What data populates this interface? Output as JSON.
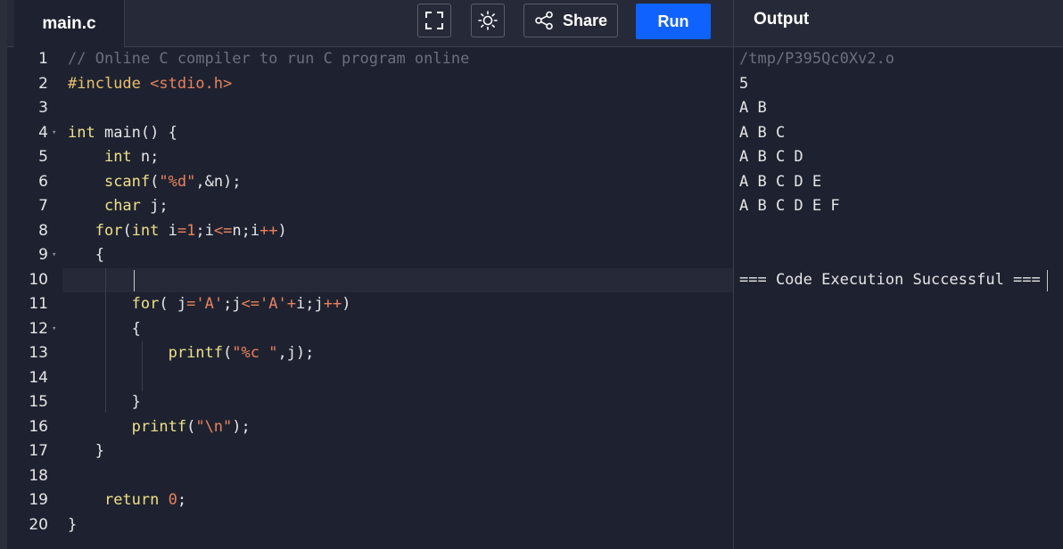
{
  "editor": {
    "file_name": "main.c",
    "lines": [
      {
        "n": "1",
        "tokens": [
          {
            "t": "// Online C compiler to run C program online",
            "c": "cm"
          }
        ]
      },
      {
        "n": "2",
        "tokens": [
          {
            "t": "#include ",
            "c": "inc"
          },
          {
            "t": "<stdio.h>",
            "c": "str"
          }
        ]
      },
      {
        "n": "3",
        "tokens": []
      },
      {
        "n": "4",
        "fold": true,
        "tokens": [
          {
            "t": "int",
            "c": "kw"
          },
          {
            "t": " main() {",
            "c": ""
          }
        ]
      },
      {
        "n": "5",
        "tokens": [
          {
            "t": "    ",
            "c": ""
          },
          {
            "t": "int",
            "c": "kw"
          },
          {
            "t": " n;",
            "c": ""
          }
        ]
      },
      {
        "n": "6",
        "tokens": [
          {
            "t": "    ",
            "c": ""
          },
          {
            "t": "scanf",
            "c": "kw"
          },
          {
            "t": "(",
            "c": ""
          },
          {
            "t": "\"%d\"",
            "c": "str"
          },
          {
            "t": ",&n);",
            "c": ""
          }
        ]
      },
      {
        "n": "7",
        "tokens": [
          {
            "t": "    ",
            "c": ""
          },
          {
            "t": "char",
            "c": "kw"
          },
          {
            "t": " j;",
            "c": ""
          }
        ]
      },
      {
        "n": "8",
        "tokens": [
          {
            "t": "   ",
            "c": ""
          },
          {
            "t": "for",
            "c": "kw"
          },
          {
            "t": "(",
            "c": ""
          },
          {
            "t": "int",
            "c": "kw"
          },
          {
            "t": " i",
            "c": ""
          },
          {
            "t": "=1",
            "c": "num"
          },
          {
            "t": ";i",
            "c": ""
          },
          {
            "t": "<=",
            "c": "str"
          },
          {
            "t": "n;i",
            "c": ""
          },
          {
            "t": "++",
            "c": "str"
          },
          {
            "t": ")",
            "c": ""
          }
        ]
      },
      {
        "n": "9",
        "fold": true,
        "tokens": [
          {
            "t": "   {",
            "c": ""
          }
        ]
      },
      {
        "n": "10",
        "tokens": []
      },
      {
        "n": "11",
        "tokens": [
          {
            "t": "       ",
            "c": ""
          },
          {
            "t": "for",
            "c": "kw"
          },
          {
            "t": "( j",
            "c": ""
          },
          {
            "t": "=",
            "c": "str"
          },
          {
            "t": "'A'",
            "c": "str"
          },
          {
            "t": ";j",
            "c": ""
          },
          {
            "t": "<=",
            "c": "str"
          },
          {
            "t": "'A'",
            "c": "str"
          },
          {
            "t": "+",
            "c": "str"
          },
          {
            "t": "i;j",
            "c": ""
          },
          {
            "t": "++",
            "c": "str"
          },
          {
            "t": ")",
            "c": ""
          }
        ]
      },
      {
        "n": "12",
        "fold": true,
        "tokens": [
          {
            "t": "       {",
            "c": ""
          }
        ]
      },
      {
        "n": "13",
        "tokens": [
          {
            "t": "           ",
            "c": ""
          },
          {
            "t": "printf",
            "c": "kw"
          },
          {
            "t": "(",
            "c": ""
          },
          {
            "t": "\"%c \"",
            "c": "str"
          },
          {
            "t": ",j);",
            "c": ""
          }
        ]
      },
      {
        "n": "14",
        "tokens": []
      },
      {
        "n": "15",
        "tokens": [
          {
            "t": "       }",
            "c": ""
          }
        ]
      },
      {
        "n": "16",
        "tokens": [
          {
            "t": "       ",
            "c": ""
          },
          {
            "t": "printf",
            "c": "kw"
          },
          {
            "t": "(",
            "c": ""
          },
          {
            "t": "\"\\n\"",
            "c": "str"
          },
          {
            "t": ");",
            "c": ""
          }
        ]
      },
      {
        "n": "17",
        "tokens": [
          {
            "t": "   }",
            "c": ""
          }
        ]
      },
      {
        "n": "18",
        "tokens": []
      },
      {
        "n": "19",
        "tokens": [
          {
            "t": "    ",
            "c": ""
          },
          {
            "t": "return",
            "c": "kw"
          },
          {
            "t": " ",
            "c": ""
          },
          {
            "t": "0",
            "c": "num"
          },
          {
            "t": ";",
            "c": ""
          }
        ]
      },
      {
        "n": "20",
        "tokens": [
          {
            "t": "}",
            "c": ""
          }
        ]
      }
    ]
  },
  "toolbar": {
    "fullscreen_icon": "fullscreen-icon",
    "theme_icon": "sun-icon",
    "share_icon": "share-icon",
    "share_label": "Share",
    "run_label": "Run"
  },
  "output": {
    "title": "Output",
    "lines": [
      "/tmp/P395Qc0Xv2.o",
      "5",
      "A B",
      "A B C",
      "A B C D",
      "A B C D E",
      "A B C D E F",
      "",
      "",
      "=== Code Execution Successful ==="
    ]
  },
  "colors": {
    "background": "#1e2230",
    "header": "#262a38",
    "run_button": "#0f62fe",
    "keyword": "#ede08a",
    "string": "#e8825e",
    "comment": "#6a6e7e"
  }
}
